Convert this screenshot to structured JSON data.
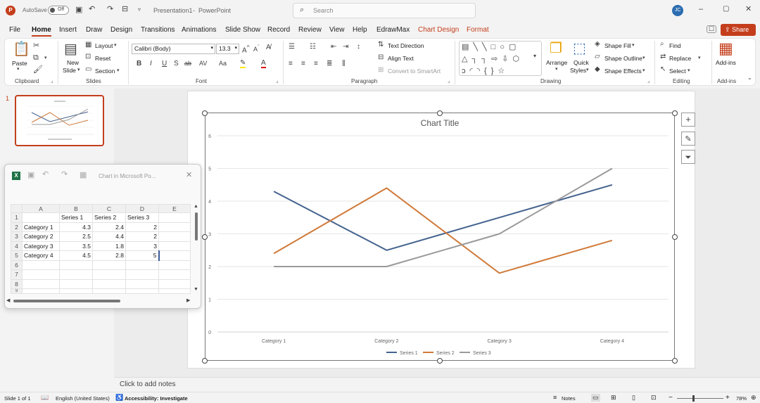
{
  "titlebar": {
    "autosave_label": "AutoSave",
    "autosave_state": "Off",
    "doc_title": "Presentation1",
    "app_name": "PowerPoint",
    "search_placeholder": "Search",
    "user_initials": "JC",
    "separator": "-"
  },
  "tabs": [
    "File",
    "Home",
    "Insert",
    "Draw",
    "Design",
    "Transitions",
    "Animations",
    "Slide Show",
    "Record",
    "Review",
    "View",
    "Help",
    "EdrawMax",
    "Chart Design",
    "Format"
  ],
  "share_label": "Share",
  "ribbon": {
    "clipboard": {
      "paste": "Paste",
      "group": "Clipboard"
    },
    "slides": {
      "new_slide": "New",
      "new_slide2": "Slide",
      "layout": "Layout",
      "reset": "Reset",
      "section": "Section",
      "group": "Slides"
    },
    "font": {
      "name": "Calibri (Body)",
      "size": "13.3",
      "group": "Font"
    },
    "paragraph": {
      "text_direction": "Text Direction",
      "align_text": "Align Text",
      "smartart": "Convert to SmartArt",
      "group": "Paragraph"
    },
    "drawing": {
      "arrange": "Arrange",
      "quick_styles": "Quick",
      "quick_styles2": "Styles",
      "shape_fill": "Shape Fill",
      "shape_outline": "Shape Outline",
      "shape_effects": "Shape Effects",
      "group": "Drawing"
    },
    "editing": {
      "find": "Find",
      "replace": "Replace",
      "select": "Select",
      "group": "Editing"
    },
    "addins": {
      "label": "Add-ins",
      "group": "Add-ins"
    }
  },
  "thumbnail": {
    "number": "1"
  },
  "excel": {
    "title": "Chart in Microsoft Po...",
    "columns": [
      "A",
      "B",
      "C",
      "D",
      "E"
    ],
    "rows": [
      {
        "n": "1",
        "a": "",
        "b": "Series 1",
        "c": "Series 2",
        "d": "Series 3"
      },
      {
        "n": "2",
        "a": "Category 1",
        "b": "4.3",
        "c": "2.4",
        "d": "2"
      },
      {
        "n": "3",
        "a": "Category 2",
        "b": "2.5",
        "c": "4.4",
        "d": "2"
      },
      {
        "n": "4",
        "a": "Category 3",
        "b": "3.5",
        "c": "1.8",
        "d": "3"
      },
      {
        "n": "5",
        "a": "Category 4",
        "b": "4.5",
        "c": "2.8",
        "d": "5"
      },
      {
        "n": "6",
        "a": "",
        "b": "",
        "c": "",
        "d": ""
      },
      {
        "n": "7",
        "a": "",
        "b": "",
        "c": "",
        "d": ""
      },
      {
        "n": "8",
        "a": "",
        "b": "",
        "c": "",
        "d": ""
      },
      {
        "n": "9",
        "a": "",
        "b": "",
        "c": "",
        "d": ""
      }
    ]
  },
  "chart_data": {
    "type": "line",
    "title": "Chart Title",
    "categories": [
      "Category 1",
      "Category 2",
      "Category 3",
      "Category 4"
    ],
    "series": [
      {
        "name": "Series 1",
        "values": [
          4.3,
          2.5,
          3.5,
          4.5
        ],
        "color": "#44628f"
      },
      {
        "name": "Series 2",
        "values": [
          2.4,
          4.4,
          1.8,
          2.8
        ],
        "color": "#d07a3a"
      },
      {
        "name": "Series 3",
        "values": [
          2,
          2,
          3,
          5
        ],
        "color": "#9a9a9a"
      }
    ],
    "yticks": [
      "0",
      "1",
      "2",
      "3",
      "4",
      "5",
      "6"
    ],
    "ylim": [
      0,
      6
    ],
    "grid": true,
    "legend": "bottom"
  },
  "notes_placeholder": "Click to add notes",
  "status": {
    "slide": "Slide 1 of 1",
    "language": "English (United States)",
    "accessibility": "Accessibility: Investigate",
    "notes": "Notes",
    "zoom": "78%"
  }
}
